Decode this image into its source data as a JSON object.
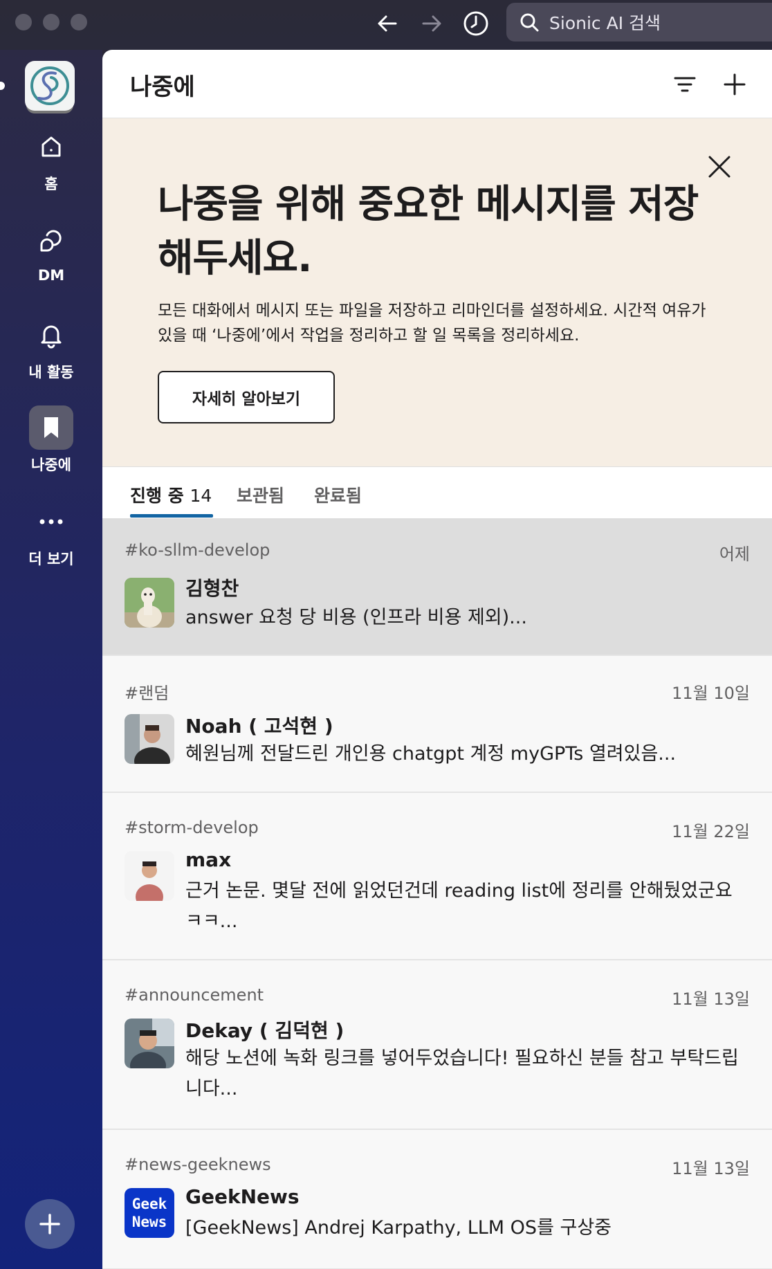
{
  "search": {
    "placeholder": "Sionic AI 검색"
  },
  "rail": {
    "items": [
      {
        "label": "홈",
        "icon": "home-icon"
      },
      {
        "label": "DM",
        "icon": "dm-icon"
      },
      {
        "label": "내 활동",
        "icon": "bell-icon"
      },
      {
        "label": "나중에",
        "icon": "bookmark-icon"
      },
      {
        "label": "더 보기",
        "icon": "more-icon"
      }
    ]
  },
  "header": {
    "title": "나중에"
  },
  "promo": {
    "heading": "나중을 위해 중요한 메시지를 저장해두세요.",
    "description": "모든 대화에서 메시지 또는 파일을 저장하고 리마인더를 설정하세요. 시간적 여유가 있을 때 ‘나중에’에서 작업을 정리하고 할 일 목록을 정리하세요.",
    "button": "자세히 알아보기"
  },
  "tabs": [
    {
      "label": "진행 중",
      "count": "14"
    },
    {
      "label": "보관됨"
    },
    {
      "label": "완료됨"
    }
  ],
  "items": [
    {
      "channel": "#ko-sllm-develop",
      "date": "어제",
      "name": "김형찬",
      "message": "answer 요청 당 비용 (인프라 비용 제외)..."
    },
    {
      "channel": "#랜덤",
      "date": "11월 10일",
      "name": "Noah ( 고석현 )",
      "message": "혜원님께 전달드린 개인용 chatgpt 계정 myGPTs 열려있음..."
    },
    {
      "channel": "#storm-develop",
      "date": "11월 22일",
      "name": "max",
      "message": "근거 논문. 몇달 전에 읽었던건데 reading list에 정리를 안해뒀었군요 ㅋㅋ..."
    },
    {
      "channel": "#announcement",
      "date": "11월 13일",
      "name": "Dekay ( 김덕현 )",
      "message": "해당 노션에 녹화 링크를 넣어두었습니다! 필요하신 분들 참고 부탁드립니다..."
    },
    {
      "channel": "#news-geeknews",
      "date": "11월 13일",
      "name": "GeekNews",
      "message": "[GeekNews] Andrej Karpathy, LLM OS를 구상중",
      "logo_text": [
        "Geek",
        "News"
      ]
    }
  ]
}
